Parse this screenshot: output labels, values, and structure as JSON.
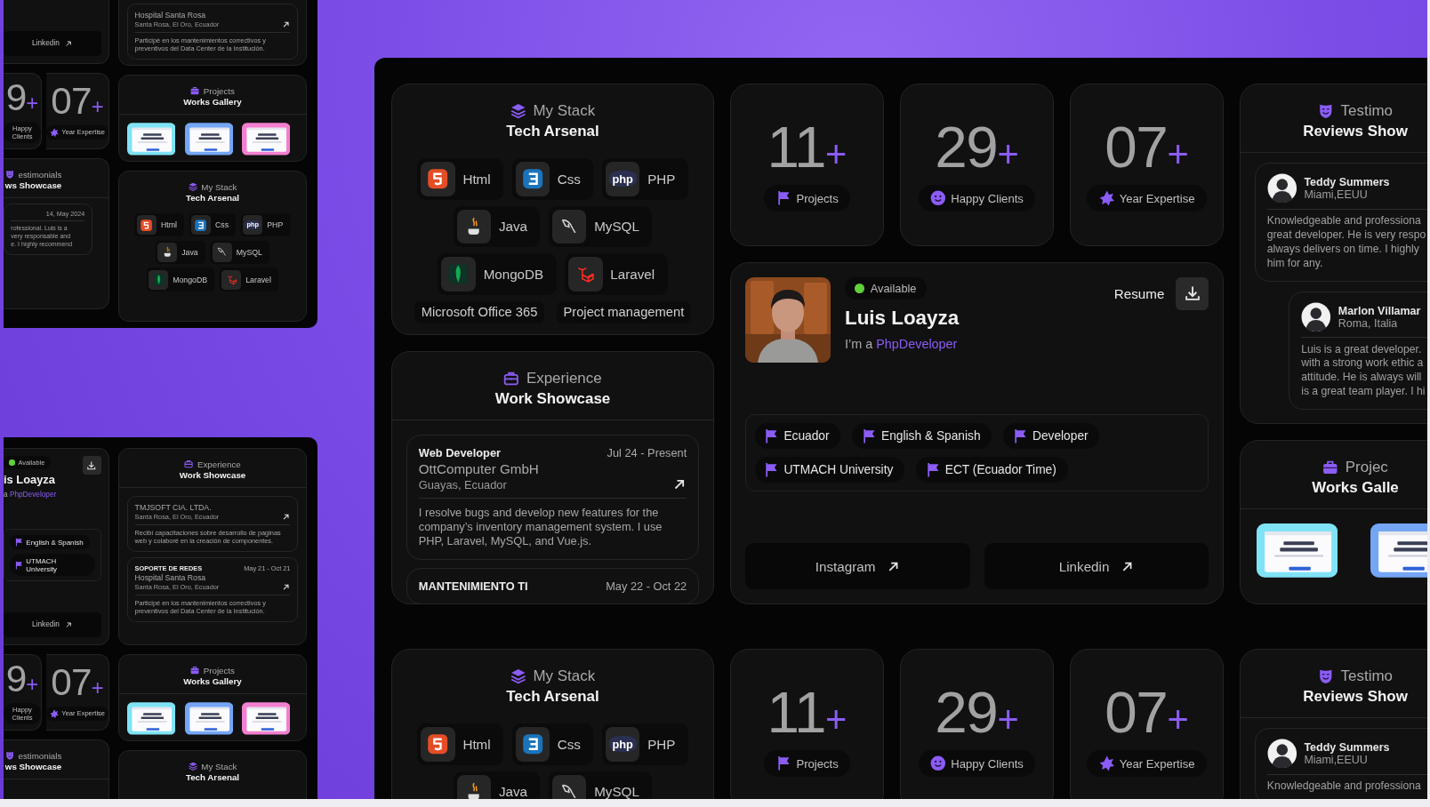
{
  "frames": [
    {
      "kind": "mini",
      "sections": [
        {
          "columns": [
            [
              {
                "kind": "social",
                "links": [
                  "Linkedin"
                ]
              },
              {
                "kind": "stats",
                "items": [
                  {
                    "kind": "plain",
                    "number": "9",
                    "suffix": "+",
                    "label": "Happy Clients"
                  },
                  {
                    "kind": "expertise",
                    "number": "07",
                    "suffix": "+",
                    "label": "Year Expertise"
                  }
                ]
              },
              {
                "kind": "testimonials",
                "title": "estimonials",
                "subtitle": "ws Showcase",
                "reviews": [
                  {
                    "date": "14, May 2024",
                    "text": "rofessional. Luis is a\nvery responsable and\ne. I highly recommend"
                  }
                ]
              }
            ],
            [
              {
                "kind": "experience",
                "items": [
                  {
                    "company": "Hospital Santa Rosa",
                    "location": "Santa Rosa, El Oro, Ecuador",
                    "text": "Participé en los mantenimientos correctivos y preventivos del Data Center de la Institución."
                  }
                ]
              },
              {
                "kind": "projects",
                "title": "Projects",
                "subtitle": "Works Gallery",
                "thumbs": [
                  {
                    "color": "#7fe3f5"
                  },
                  {
                    "color": "#74a6f5"
                  },
                  {
                    "color": "#f27fcf"
                  }
                ]
              },
              {
                "kind": "stack",
                "title": "My Stack",
                "subtitle": "Tech Arsenal",
                "rows": [
                  [
                    {
                      "kind": "html",
                      "name": "Html"
                    },
                    {
                      "kind": "css",
                      "name": "Css"
                    },
                    {
                      "kind": "php",
                      "name": "PHP",
                      "logo_text": "php"
                    }
                  ],
                  [
                    {
                      "kind": "java",
                      "name": "Java"
                    },
                    {
                      "kind": "mysql",
                      "name": "MySQL"
                    }
                  ],
                  [
                    {
                      "kind": "mongodb",
                      "name": "MongoDB"
                    },
                    {
                      "kind": "laravel",
                      "name": "Laravel"
                    }
                  ]
                ]
              }
            ]
          ]
        }
      ]
    },
    {
      "kind": "mini",
      "sections": [
        {
          "columns": [
            [
              {
                "kind": "profile",
                "status": "Available",
                "available": true,
                "name": "is Loayza",
                "intro": "a ",
                "role": "PhpDeveloper",
                "tags": [
                  "English & Spanish",
                  "UTMACH University"
                ],
                "links": [
                  "Linkedin"
                ]
              },
              {
                "kind": "stats",
                "items": [
                  {
                    "kind": "plain",
                    "number": "9",
                    "suffix": "+",
                    "label": "Happy Clients"
                  },
                  {
                    "kind": "expertise",
                    "number": "07",
                    "suffix": "+",
                    "label": "Year Expertise"
                  }
                ]
              },
              {
                "kind": "testimonials",
                "title": "estimonials",
                "subtitle": "ws Showcase"
              }
            ],
            [
              {
                "kind": "experience",
                "title": "Experience",
                "subtitle": "Work Showcase",
                "items": [
                  {
                    "company": "TMJSOFT CIA. LTDA.",
                    "location": "Santa Rosa, El Oro, Ecuador",
                    "text": "Recibí capacitaciones sobre desarrollo de paginas web y colaboré en la creación de componentes."
                  },
                  {
                    "role": "SOPORTE DE REDES",
                    "dates": "May 21 - Oct 21",
                    "company": "Hospital Santa Rosa",
                    "location": "Santa Rosa, El Oro, Ecuador",
                    "text": "Participé en los mantenimientos correctivos y preventivos del Data Center de la Institución."
                  }
                ]
              },
              {
                "kind": "projects",
                "title": "Projects",
                "subtitle": "Works Gallery",
                "thumbs": [
                  {
                    "color": "#7fe3f5"
                  },
                  {
                    "color": "#74a6f5"
                  },
                  {
                    "color": "#f27fcf"
                  }
                ]
              },
              {
                "kind": "stack",
                "title": "My Stack",
                "subtitle": "Tech Arsenal"
              }
            ]
          ]
        }
      ]
    },
    {
      "kind": "main",
      "sections": [
        {
          "columns": [
            [
              {
                "kind": "stack",
                "title": "My Stack",
                "subtitle": "Tech Arsenal",
                "rows": [
                  [
                    {
                      "kind": "html",
                      "name": "Html"
                    },
                    {
                      "kind": "css",
                      "name": "Css"
                    },
                    {
                      "kind": "php",
                      "name": "PHP",
                      "logo_text": "php"
                    }
                  ],
                  [
                    {
                      "kind": "java",
                      "name": "Java"
                    },
                    {
                      "kind": "mysql",
                      "name": "MySQL"
                    }
                  ],
                  [
                    {
                      "kind": "mongodb",
                      "name": "MongoDB"
                    },
                    {
                      "kind": "laravel",
                      "name": "Laravel"
                    }
                  ]
                ],
                "extras": [
                  "Microsoft Office 365",
                  "Project management"
                ]
              },
              {
                "kind": "experience",
                "title": "Experience",
                "subtitle": "Work Showcase",
                "items": [
                  {
                    "role": "Web Developer",
                    "dates": "Jul 24 - Present",
                    "company": "OttComputer GmbH",
                    "location": "Guayas, Ecuador",
                    "text": "I resolve bugs and develop new features for the company’s inventory management system. I use PHP, Laravel, MySQL, and Vue.js."
                  },
                  {
                    "role": "MANTENIMIENTO TI",
                    "dates": "May 22 - Oct 22"
                  }
                ]
              }
            ],
            [
              {
                "kind": "stats",
                "items": [
                  {
                    "kind": "projects",
                    "number": "11",
                    "suffix": "+",
                    "label": "Projects"
                  },
                  {
                    "kind": "clients",
                    "number": "29",
                    "suffix": "+",
                    "label": "Happy Clients"
                  },
                  {
                    "kind": "expertise",
                    "number": "07",
                    "suffix": "+",
                    "label": "Year Expertise"
                  }
                ]
              },
              {
                "kind": "profile",
                "photo": {
                  "kind": "picture"
                },
                "status": "Available",
                "available": true,
                "name": "Luis Loayza",
                "intro": "I’m a ",
                "role": "PhpDeveloper",
                "resume": "Resume",
                "tags": [
                  "Ecuador",
                  "English & Spanish",
                  "Developer",
                  "UTMACH University",
                  "ECT (Ecuador Time)"
                ],
                "links": [
                  "Instagram",
                  "Linkedin"
                ]
              }
            ],
            [
              {
                "kind": "testimonials",
                "title": "Testimo",
                "subtitle": "Reviews Show",
                "reviews": [
                  {
                    "name": "Teddy Summers",
                    "place": "Miami,EEUU",
                    "text": "Knowledgeable and professiona\ngreat developer. He is very respo\nalways delivers on time. I highly\nhim for any."
                  },
                  {
                    "name": "Marlon Villamar",
                    "place": "Roma, Italia",
                    "text": "Luis is a great developer.\nwith a strong work ethic a\nattitude. He is always will\nis a great team player. I hi"
                  }
                ]
              },
              {
                "kind": "projects",
                "title": "Projec",
                "subtitle": "Works Galle",
                "thumbs": [
                  {
                    "color": "#7fe3f5"
                  },
                  {
                    "color": "#74a6f5"
                  }
                ]
              }
            ]
          ]
        },
        {
          "columns": [
            [
              {
                "kind": "stack",
                "title": "My Stack",
                "subtitle": "Tech Arsenal",
                "rows": [
                  [
                    {
                      "kind": "html",
                      "name": "Html"
                    },
                    {
                      "kind": "css",
                      "name": "Css"
                    },
                    {
                      "kind": "php",
                      "name": "PHP",
                      "logo_text": "php"
                    }
                  ],
                  [
                    {
                      "kind": "java",
                      "name": "Java"
                    },
                    {
                      "kind": "mysql",
                      "name": "MySQL"
                    }
                  ]
                ]
              }
            ],
            [
              {
                "kind": "stats",
                "items": [
                  {
                    "kind": "projects",
                    "number": "11",
                    "suffix": "+",
                    "label": "Projects"
                  },
                  {
                    "kind": "clients",
                    "number": "29",
                    "suffix": "+",
                    "label": "Happy Clients"
                  },
                  {
                    "kind": "expertise",
                    "number": "07",
                    "suffix": "+",
                    "label": "Year Expertise"
                  }
                ]
              }
            ],
            [
              {
                "kind": "testimonials",
                "title": "Testimo",
                "subtitle": "Reviews Show",
                "reviews": [
                  {
                    "name": "Teddy Summers",
                    "place": "Miami,EEUU",
                    "text": "Knowledgeable and professiona"
                  }
                ]
              }
            ]
          ]
        }
      ]
    }
  ]
}
